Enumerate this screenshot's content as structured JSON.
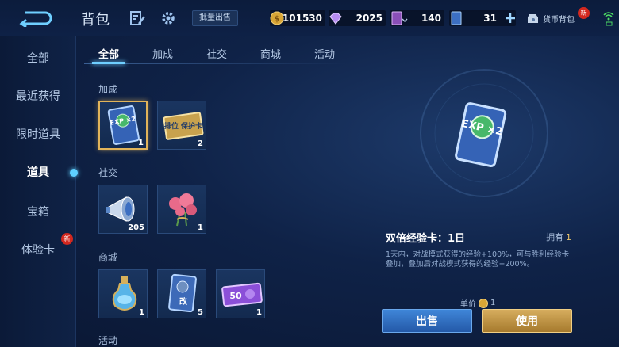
{
  "header": {
    "title": "背包",
    "batch_sell_label": "批量出售",
    "currencies": {
      "gold": "101530",
      "diamond": "2025",
      "card": "140",
      "ticket": "31"
    },
    "wallet_label": "货币背包",
    "wallet_badge": "新"
  },
  "sidebar": {
    "items": [
      {
        "label": "全部"
      },
      {
        "label": "最近获得"
      },
      {
        "label": "限时道具"
      },
      {
        "label": "道具"
      },
      {
        "label": "宝箱"
      },
      {
        "label": "体验卡"
      }
    ],
    "active_index": 3,
    "badge_on_experience": "新"
  },
  "tabs": {
    "items": [
      {
        "label": "全部"
      },
      {
        "label": "加成"
      },
      {
        "label": "社交"
      },
      {
        "label": "商城"
      },
      {
        "label": "活动"
      }
    ],
    "active_index": 0
  },
  "sections": [
    {
      "label": "加成",
      "items": [
        {
          "icon": "exp-card-icon",
          "count": "1",
          "selected": true,
          "text": "EXP ×2"
        },
        {
          "icon": "rank-protect-card-icon",
          "count": "2",
          "text": "排位 保护卡"
        }
      ]
    },
    {
      "label": "社交",
      "items": [
        {
          "icon": "megaphone-icon",
          "count": "205"
        },
        {
          "icon": "roses-icon",
          "count": "1"
        }
      ]
    },
    {
      "label": "商城",
      "items": [
        {
          "icon": "magic-bottle-icon",
          "count": "1"
        },
        {
          "icon": "rename-card-icon",
          "count": "5",
          "text": "改"
        },
        {
          "icon": "coupon-icon",
          "count": "1",
          "text": "50"
        }
      ]
    },
    {
      "label": "活动",
      "items": []
    }
  ],
  "detail": {
    "name": "双倍经验卡：1日",
    "owned_label": "拥有",
    "owned_value": "1",
    "description": "1天内，对战模式获得的经验+100%，可与胜利经验卡叠加，叠加后对战模式获得的经验+200%。",
    "unit_price_label": "单价",
    "unit_price_value": "1",
    "sell_label": "出售",
    "use_label": "使用"
  },
  "colors": {
    "accent_gold": "#e2b45a",
    "accent_blue": "#6fcfff",
    "badge_red": "#d3281f"
  }
}
